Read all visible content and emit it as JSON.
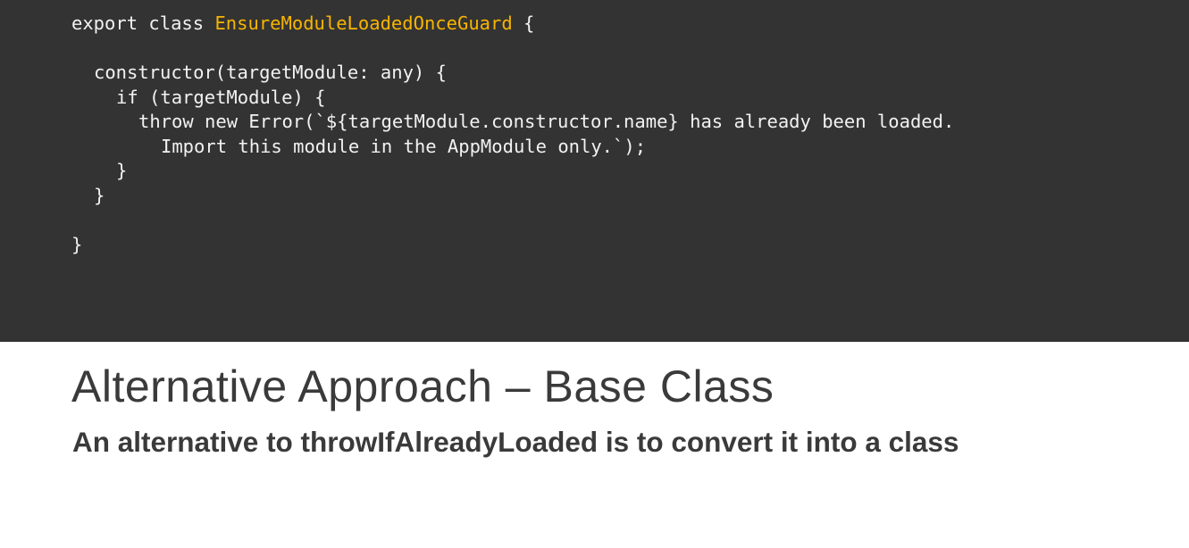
{
  "code": {
    "line1_prefix": "export class ",
    "line1_class_name": "EnsureModuleLoadedOnceGuard",
    "line1_suffix": " {",
    "line2": "constructor(targetModule: any) {",
    "line3": "if (targetModule) {",
    "line4": "throw new Error(`${targetModule.constructor.name} has already been loaded.",
    "line5": "Import this module in the AppModule only.`);",
    "line6": "}",
    "line7": "}",
    "line8": "}"
  },
  "slide": {
    "title": "Alternative Approach – Base Class",
    "subtitle": "An alternative to throwIfAlreadyLoaded is to convert it into a class"
  },
  "colors": {
    "code_background": "#333333",
    "code_text": "#f2f2f2",
    "class_name_highlight": "#f8b500",
    "heading_text": "#3a3a3a"
  }
}
